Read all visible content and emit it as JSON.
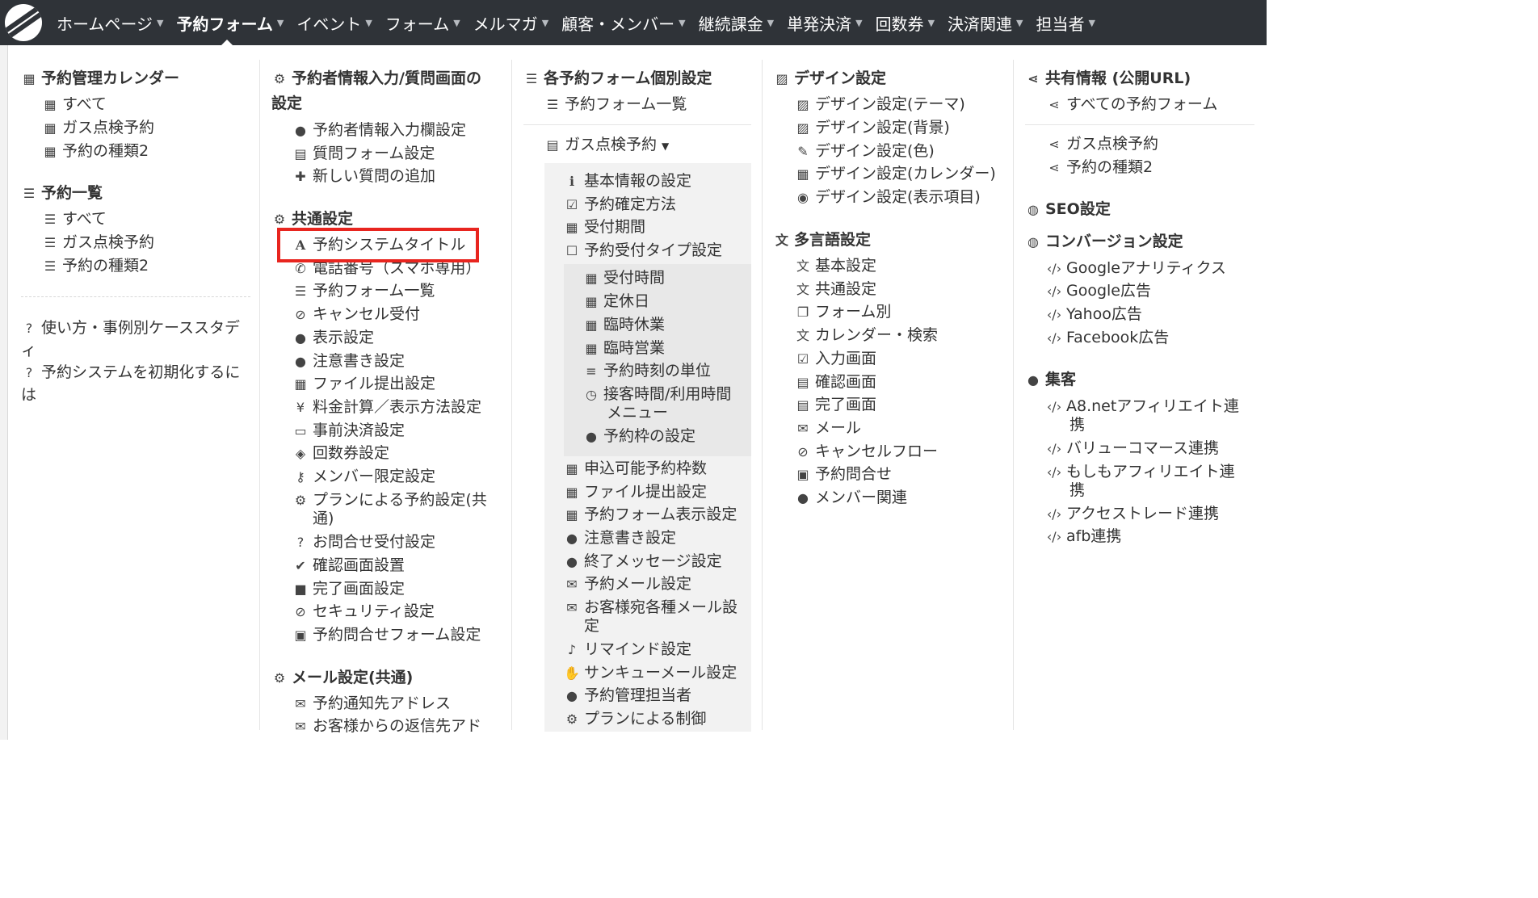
{
  "nav": {
    "items": [
      {
        "label": "ホームページ"
      },
      {
        "label": "予約フォーム"
      },
      {
        "label": "イベント"
      },
      {
        "label": "フォーム"
      },
      {
        "label": "メルマガ"
      },
      {
        "label": "顧客・メンバー"
      },
      {
        "label": "継続課金"
      },
      {
        "label": "単発決済"
      },
      {
        "label": "回数券"
      },
      {
        "label": "決済関連"
      },
      {
        "label": "担当者"
      }
    ]
  },
  "col1": {
    "calendar_head": "予約管理カレンダー",
    "cal_all": "すべて",
    "cal_gas": "ガス点検予約",
    "cal_type2": "予約の種類2",
    "list_head": "予約一覧",
    "list_all": "すべて",
    "list_gas": "ガス点検予約",
    "list_type2": "予約の種類2",
    "help1_a": "使い方・事例別ケーススタデ",
    "help1_b": "ィ",
    "help2_a": "予約システムを初期化するに",
    "help2_b": "は"
  },
  "col2": {
    "head1_a": "予約者情報入力/質問画面の",
    "head1_b": "設定",
    "i1": "予約者情報入力欄設定",
    "i2": "質問フォーム設定",
    "i3": "新しい質問の追加",
    "head2": "共通設定",
    "c1": "予約システムタイトル",
    "c2": "電話番号（スマホ専用）",
    "c3": "予約フォーム一覧",
    "c4": "キャンセル受付",
    "c5": "表示設定",
    "c6": "注意書き設定",
    "c7": "ファイル提出設定",
    "c8": "料金計算／表示方法設定",
    "c9": "事前決済設定",
    "c10": "回数券設定",
    "c11": "メンバー限定設定",
    "c12_a": "プランによる予約設定(共",
    "c12_b": "通)",
    "c13": "お問合せ受付設定",
    "c14": "確認画面設置",
    "c15": "完了画面設定",
    "c16": "セキュリティ設定",
    "c17": "予約問合せフォーム設定",
    "head3": "メール設定(共通)",
    "m1": "予約通知先アドレス",
    "m2": "お客様からの返信先アド"
  },
  "col3": {
    "head1": "各予約フォーム個別設定",
    "list": "予約フォーム一覧",
    "form_select": "ガス点検予約",
    "f1": "基本情報の設定",
    "f2": "予約確定方法",
    "f3": "受付期間",
    "f4": "予約受付タイプ設定",
    "s1": "受付時間",
    "s2": "定休日",
    "s3": "臨時休業",
    "s4": "臨時営業",
    "s5": "予約時刻の単位",
    "s6_a": "接客時間/利用時間",
    "s6_b": "メニュー",
    "s7": "予約枠の設定",
    "g1": "申込可能予約枠数",
    "g2": "ファイル提出設定",
    "g3": "予約フォーム表示設定",
    "g4": "注意書き設定",
    "g5": "終了メッセージ設定",
    "g6": "予約メール設定",
    "g7_a": "お客様宛各種メール設",
    "g7_b": "定",
    "g8": "リマインド設定",
    "g9": "サンキューメール設定",
    "g10": "予約管理担当者",
    "g11": "プランによる制御"
  },
  "col4": {
    "head1": "デザイン設定",
    "d1": "デザイン設定(テーマ)",
    "d2": "デザイン設定(背景)",
    "d3": "デザイン設定(色)",
    "d4": "デザイン設定(カレンダー)",
    "d5": "デザイン設定(表示項目)",
    "head2": "多言語設定",
    "l1": "基本設定",
    "l2": "共通設定",
    "l3": "フォーム別",
    "l4": "カレンダー・検索",
    "l5": "入力画面",
    "l6": "確認画面",
    "l7": "完了画面",
    "l8": "メール",
    "l9": "キャンセルフロー",
    "l10": "予約問合せ",
    "l11": "メンバー関連"
  },
  "col5": {
    "head1": "共有情報 (公開URL)",
    "share_all": "すべての予約フォーム",
    "share_gas": "ガス点検予約",
    "share_type2": "予約の種類2",
    "seo": "SEO設定",
    "conv": "コンバージョン設定",
    "cv1": "Googleアナリティクス",
    "cv2": "Google広告",
    "cv3": "Yahoo広告",
    "cv4": "Facebook広告",
    "head_collect": "集客",
    "a1_a": "A8.netアフィリエイト連",
    "a1_b": "携",
    "a2": "バリューコマース連携",
    "a3_a": "もしもアフィリエイト連",
    "a3_b": "携",
    "a4": "アクセストレード連携",
    "a5": "afb連携"
  }
}
